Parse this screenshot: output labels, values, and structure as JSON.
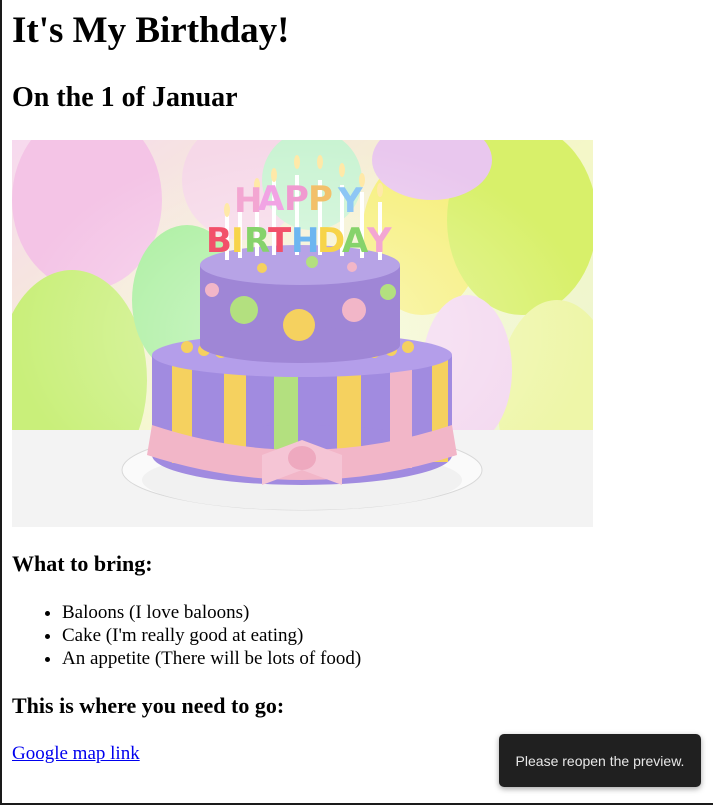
{
  "page": {
    "title": "It's My Birthday!",
    "subtitle": "On the 1 of Januar",
    "image_alt": "HAPPY BIRTHDAY",
    "bring_heading": "What to bring:",
    "bring_items": [
      "Baloons (I love baloons)",
      "Cake (I'm really good at eating)",
      "An appetite (There will be lots of food)"
    ],
    "go_heading": "This is where you need to go:",
    "map_link": "Google map link"
  },
  "toast": {
    "message": "Please reopen the preview."
  },
  "colors": {
    "link": "#0000ee",
    "toast_bg": "#202020",
    "cake_purple": "#9f86d6",
    "ribbon_pink": "#f2b6c8"
  }
}
